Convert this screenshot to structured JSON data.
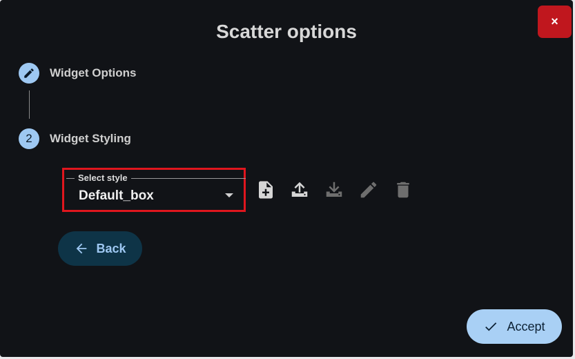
{
  "dialog": {
    "title": "Scatter options",
    "close_label": "×"
  },
  "stepper": {
    "steps": [
      {
        "label": "Widget Options",
        "icon": "pencil-icon",
        "number": ""
      },
      {
        "label": "Widget Styling",
        "icon": "",
        "number": "2"
      }
    ]
  },
  "style_select": {
    "legend": "Select style",
    "value": "Default_box"
  },
  "toolbar": {
    "icons": [
      "new-file-icon",
      "upload-icon",
      "download-icon",
      "edit-icon",
      "delete-icon"
    ],
    "active_color": "#d6d6d6",
    "disabled_color": "#6e6e6e"
  },
  "buttons": {
    "back_label": "Back",
    "accept_label": "Accept"
  },
  "colors": {
    "background": "#111317",
    "close_button": "#c0171e",
    "accent": "#9ec8f2",
    "highlight_border": "#e0161e"
  }
}
